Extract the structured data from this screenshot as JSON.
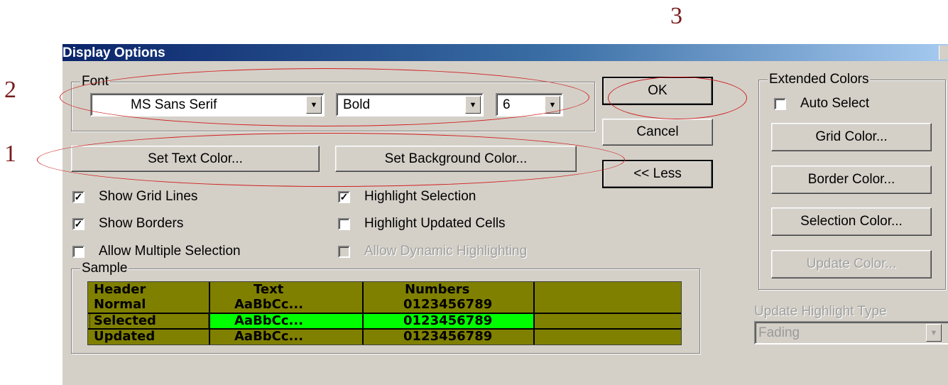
{
  "annotations": {
    "n1": "1",
    "n2": "2",
    "n3": "3"
  },
  "dialog": {
    "title": "Display Options",
    "font_group": {
      "legend": "Font",
      "font_name": "MS Sans Serif",
      "font_style": "Bold",
      "font_size": "6"
    },
    "set_text_color": "Set Text Color...",
    "set_background_color": "Set Background Color...",
    "ok": "OK",
    "cancel": "Cancel",
    "less": "<< Less",
    "options": {
      "show_grid_lines": {
        "label": "Show Grid Lines",
        "checked": true
      },
      "show_borders": {
        "label": "Show Borders",
        "checked": true
      },
      "allow_multiple_selection": {
        "label": "Allow Multiple Selection",
        "checked": false
      },
      "highlight_selection": {
        "label": "Highlight Selection",
        "checked": true
      },
      "highlight_updated_cells": {
        "label": "Highlight Updated Cells",
        "checked": false
      },
      "allow_dynamic_highlighting": {
        "label": "Allow Dynamic Highlighting",
        "checked": false,
        "disabled": true
      }
    },
    "sample": {
      "legend": "Sample",
      "headers": [
        "Header",
        "Text",
        "Numbers"
      ],
      "rows": [
        {
          "label": "Normal",
          "text": "AaBbCc...",
          "numbers": "0123456789"
        },
        {
          "label": "Selected",
          "text": "AaBbCc...",
          "numbers": "0123456789"
        },
        {
          "label": "Updated",
          "text": "AaBbCc...",
          "numbers": "0123456789"
        }
      ],
      "colors": {
        "background": "#808000",
        "selected": "#00ff00"
      }
    },
    "extended_colors": {
      "legend": "Extended Colors",
      "auto_select": {
        "label": "Auto Select",
        "checked": false
      },
      "grid_color": "Grid Color...",
      "border_color": "Border Color...",
      "selection_color": "Selection Color...",
      "update_color": "Update Color..."
    },
    "update_highlight": {
      "label": "Update Highlight Type",
      "value": "Fading"
    }
  }
}
